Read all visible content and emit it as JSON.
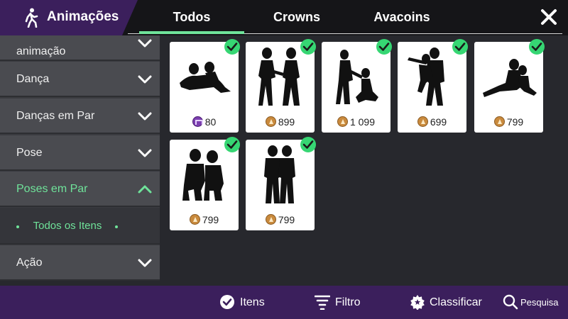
{
  "header": {
    "title": "Animações",
    "title_icon": "walking-person-icon",
    "tabs": [
      {
        "label": "Todos",
        "active": true
      },
      {
        "label": "Crowns",
        "active": false
      },
      {
        "label": "Avacoins",
        "active": false
      }
    ],
    "close_icon": "close-icon",
    "accent_color": "#6fe39a"
  },
  "sidebar": {
    "items": [
      {
        "label": "animação",
        "state": "collapsed",
        "partially_hidden": true
      },
      {
        "label": "Dança",
        "state": "collapsed"
      },
      {
        "label": "Danças em Par",
        "state": "collapsed"
      },
      {
        "label": "Pose",
        "state": "collapsed"
      },
      {
        "label": "Poses em Par",
        "state": "expanded"
      },
      {
        "label": "Ação",
        "state": "collapsed"
      }
    ],
    "subitem": {
      "label": "Todos os Itens"
    }
  },
  "cards": [
    {
      "price": "80",
      "currency": "crown",
      "owned": true,
      "icon": "reclining-couple-silhouette-icon"
    },
    {
      "price": "899",
      "currency": "avacoin",
      "owned": true,
      "icon": "holding-hands-silhouette-icon"
    },
    {
      "price": "1 099",
      "currency": "avacoin",
      "owned": true,
      "icon": "kneeling-couple-silhouette-icon"
    },
    {
      "price": "699",
      "currency": "avacoin",
      "owned": true,
      "icon": "carrying-couple-silhouette-icon"
    },
    {
      "price": "799",
      "currency": "avacoin",
      "owned": true,
      "icon": "sitting-couple-silhouette-icon"
    },
    {
      "price": "799",
      "currency": "avacoin",
      "owned": true,
      "icon": "crouching-couple-silhouette-icon"
    },
    {
      "price": "799",
      "currency": "avacoin",
      "owned": true,
      "icon": "standing-couple-silhouette-icon"
    }
  ],
  "bottom_bar": {
    "itens": {
      "label": "Itens",
      "icon": "check-circle-icon"
    },
    "filtro": {
      "label": "Filtro",
      "icon": "filter-lines-icon"
    },
    "classificar": {
      "label": "Classificar",
      "icon": "star-badge-icon"
    },
    "pesquisa": {
      "label": "Pesquisa",
      "icon": "search-icon"
    }
  }
}
